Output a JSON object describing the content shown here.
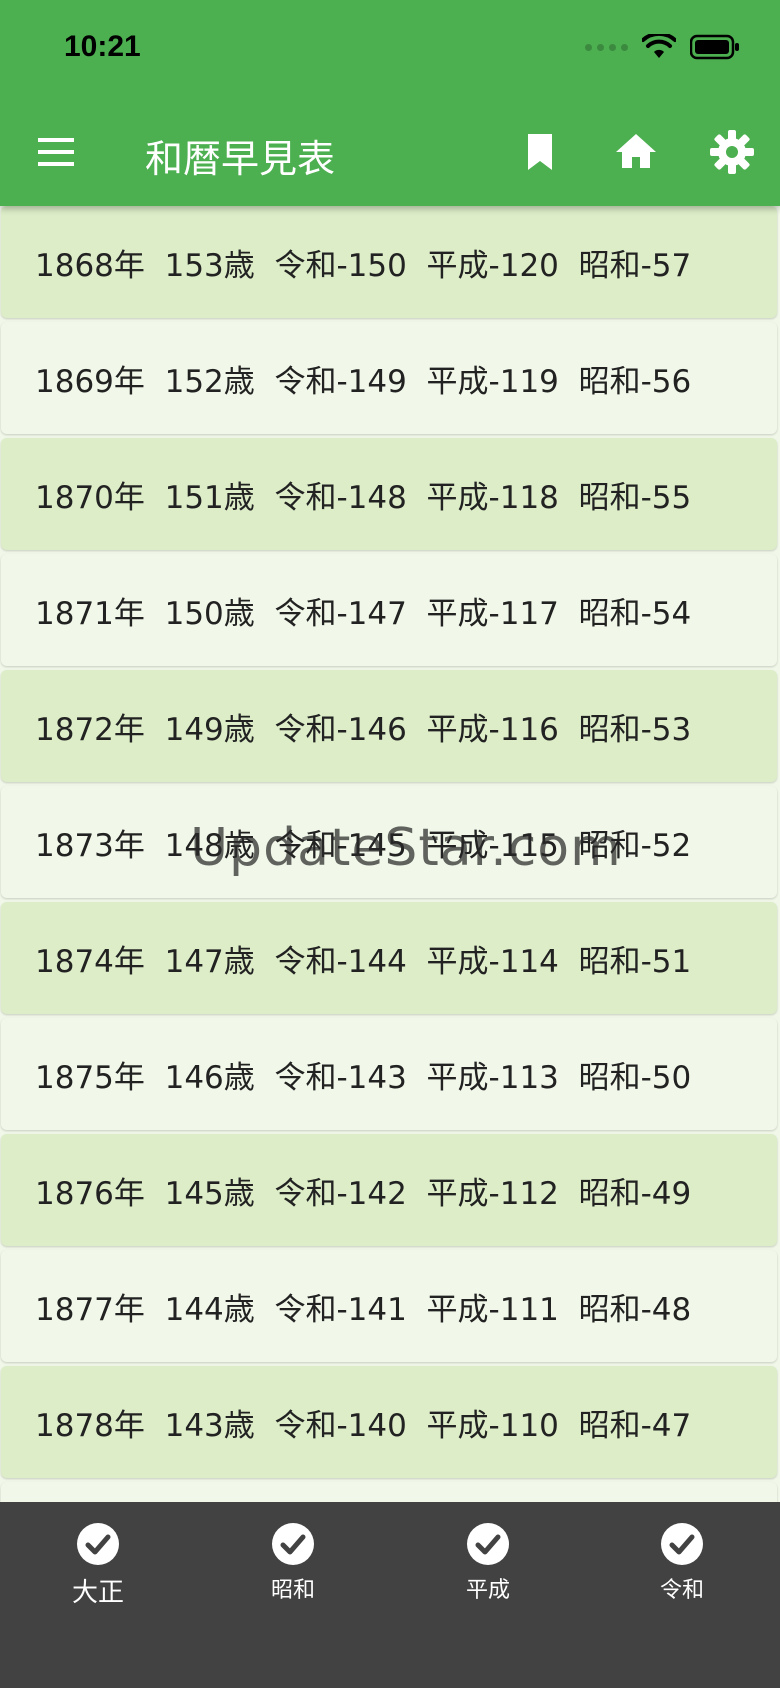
{
  "status_bar": {
    "time": "10:21"
  },
  "app_bar": {
    "title": "和暦早見表",
    "icons": [
      "menu-icon",
      "bookmark-icon",
      "home-icon",
      "settings-icon"
    ]
  },
  "rows": [
    "1868年  153歳  令和-150  平成-120  昭和-57",
    "1869年  152歳  令和-149  平成-119  昭和-56",
    "1870年  151歳  令和-148  平成-118  昭和-55",
    "1871年  150歳  令和-147  平成-117  昭和-54",
    "1872年  149歳  令和-146  平成-116  昭和-53",
    "1873年  148歳  令和-145  平成-115  昭和-52",
    "1874年  147歳  令和-144  平成-114  昭和-51",
    "1875年  146歳  令和-143  平成-113  昭和-50",
    "1876年  145歳  令和-142  平成-112  昭和-49",
    "1877年  144歳  令和-141  平成-111  昭和-48",
    "1878年  143歳  令和-140  平成-110  昭和-47"
  ],
  "watermark": "UpdateStar.com",
  "bottom_nav": [
    {
      "label": "大正",
      "icon": "check-circle-icon"
    },
    {
      "label": "昭和",
      "icon": "check-circle-icon"
    },
    {
      "label": "平成",
      "icon": "check-circle-icon"
    },
    {
      "label": "令和",
      "icon": "check-circle-icon"
    }
  ],
  "colors": {
    "app_bar": "#4caf50",
    "row_odd": "#dcedc8",
    "row_even": "#f1f8e9",
    "bottom_bar": "#424242"
  }
}
